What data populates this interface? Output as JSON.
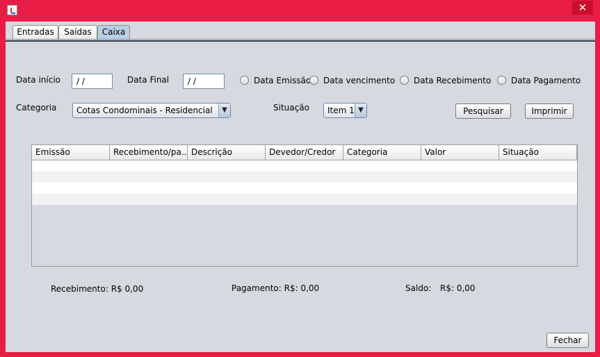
{
  "window": {
    "close_glyph": "✕",
    "java_icon": "java-icon"
  },
  "tabs": [
    {
      "label": "Entradas",
      "selected": false
    },
    {
      "label": "Saídas",
      "selected": false
    },
    {
      "label": "Caixa",
      "selected": true
    }
  ],
  "filters": {
    "data_inicio_label": "Data início",
    "data_inicio_value": "/ /",
    "data_final_label": "Data Final",
    "data_final_value": "/ /",
    "radios": [
      {
        "label": "Data Emissão",
        "checked": false
      },
      {
        "label": "Data vencimento",
        "checked": false
      },
      {
        "label": "Data Recebimento",
        "checked": false
      },
      {
        "label": "Data Pagamento",
        "checked": false
      }
    ],
    "categoria_label": "Categoria",
    "categoria_value": "Cotas Condominais - Residencial",
    "situacao_label": "Situação",
    "situacao_value": "Item 1",
    "combo_arrow": "▼"
  },
  "buttons": {
    "pesquisar": "Pesquisar",
    "imprimir": "Imprimir",
    "fechar": "Fechar"
  },
  "table": {
    "columns": [
      "Emissão",
      "Recebimento/pa...",
      "Descrição",
      "Devedor/Credor",
      "Categoria",
      "Valor",
      "Situação"
    ],
    "rows": [
      [],
      [],
      [],
      []
    ]
  },
  "totals": {
    "recebimento": "Recebimento: R$ 0,00",
    "pagamento": "Pagamento: R$: 0,00",
    "saldo_label": "Saldo:",
    "saldo_value": "R$: 0,00"
  },
  "colors": {
    "window_frame": "#e81c44",
    "close_button": "#c8102e",
    "panel_background": "#d6d9df",
    "selected_tab": "#b8cfe5"
  }
}
